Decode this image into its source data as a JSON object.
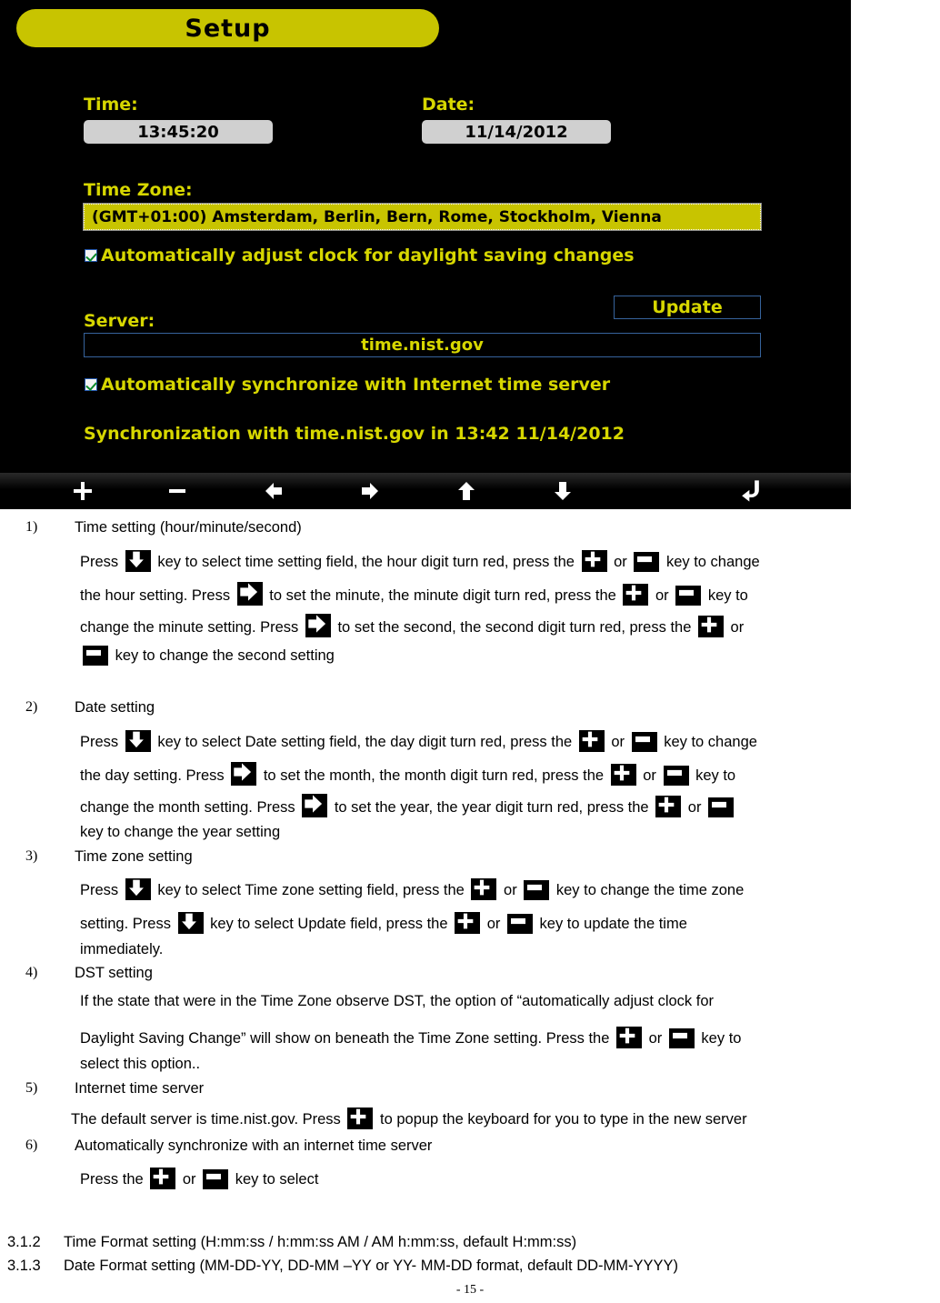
{
  "device": {
    "title": "Setup",
    "time_label": "Time:",
    "time_value": "13:45:20",
    "date_label": "Date:",
    "date_value": "11/14/2012",
    "timezone_label": "Time Zone:",
    "timezone_value": "(GMT+01:00) Amsterdam, Berlin, Bern, Rome, Stockholm, Vienna",
    "dst_checkbox_label": "Automatically adjust clock for daylight saving changes",
    "server_label": "Server:",
    "update_button": "Update",
    "server_value": "time.nist.gov",
    "sync_checkbox_label": "Automatically synchronize with Internet time server",
    "sync_status": "Synchronization with time.nist.gov in 13:42 11/14/2012",
    "colors": {
      "background": "#000000",
      "accent_yellow": "#c8c400",
      "label_yellow": "#d7d700",
      "field_grey": "#d0d0d0",
      "outline_blue": "#36639c"
    },
    "toolbar_icons": [
      "plus-icon",
      "minus-icon",
      "arrow-left-icon",
      "arrow-right-icon",
      "arrow-up-icon",
      "arrow-down-icon",
      "back-icon"
    ]
  },
  "manual": {
    "items": [
      {
        "number": "1)",
        "heading": "Time setting (hour/minute/second)",
        "lines": [
          [
            {
              "t": "text",
              "v": "Press "
            },
            {
              "t": "icon",
              "v": "arrow-down-key-icon"
            },
            {
              "t": "text",
              "v": " key to select time setting field, the hour digit turn red, press the "
            },
            {
              "t": "icon",
              "v": "plus-key-icon"
            },
            {
              "t": "text",
              "v": " or "
            },
            {
              "t": "icon",
              "v": "minus-key-icon"
            },
            {
              "t": "text",
              "v": " key to change"
            }
          ],
          [
            {
              "t": "text",
              "v": "the hour setting. Press "
            },
            {
              "t": "icon",
              "v": "arrow-right-key-icon"
            },
            {
              "t": "text",
              "v": " to set the minute, the minute digit turn red, press the "
            },
            {
              "t": "icon",
              "v": "plus-key-icon"
            },
            {
              "t": "text",
              "v": " or "
            },
            {
              "t": "icon",
              "v": "minus-key-icon"
            },
            {
              "t": "text",
              "v": " key to"
            }
          ],
          [
            {
              "t": "text",
              "v": "change the minute setting. Press "
            },
            {
              "t": "icon",
              "v": "arrow-right-key-icon"
            },
            {
              "t": "text",
              "v": " to set the second, the second digit turn red, press the "
            },
            {
              "t": "icon",
              "v": "plus-key-icon"
            },
            {
              "t": "text",
              "v": " or"
            }
          ],
          [
            {
              "t": "icon",
              "v": "minus-key-icon"
            },
            {
              "t": "text",
              "v": " key to change the second setting"
            }
          ]
        ]
      },
      {
        "number": "2)",
        "heading": "Date setting",
        "lines": [
          [
            {
              "t": "text",
              "v": "Press "
            },
            {
              "t": "icon",
              "v": "arrow-down-key-icon"
            },
            {
              "t": "text",
              "v": " key to select Date setting field, the day digit turn red, press the "
            },
            {
              "t": "icon",
              "v": "plus-key-icon"
            },
            {
              "t": "text",
              "v": " or "
            },
            {
              "t": "icon",
              "v": "minus-key-icon"
            },
            {
              "t": "text",
              "v": " key to change"
            }
          ],
          [
            {
              "t": "text",
              "v": "the day setting. Press "
            },
            {
              "t": "icon",
              "v": "arrow-right-key-icon"
            },
            {
              "t": "text",
              "v": " to set the month, the month digit turn red, press the "
            },
            {
              "t": "icon",
              "v": "plus-key-icon"
            },
            {
              "t": "text",
              "v": " or "
            },
            {
              "t": "icon",
              "v": "minus-key-icon"
            },
            {
              "t": "text",
              "v": " key to"
            }
          ],
          [
            {
              "t": "text",
              "v": "change the month setting. Press "
            },
            {
              "t": "icon",
              "v": "arrow-right-key-icon"
            },
            {
              "t": "text",
              "v": " to set the year, the year digit turn red, press the "
            },
            {
              "t": "icon",
              "v": "plus-key-icon"
            },
            {
              "t": "text",
              "v": " or "
            },
            {
              "t": "icon",
              "v": "minus-key-icon"
            }
          ],
          [
            {
              "t": "text",
              "v": "key to change the year setting"
            }
          ]
        ]
      },
      {
        "number": "3)",
        "heading": "Time zone setting",
        "lines": [
          [
            {
              "t": "text",
              "v": "Press "
            },
            {
              "t": "icon",
              "v": "arrow-down-key-icon"
            },
            {
              "t": "text",
              "v": " key to select Time zone setting field, press the "
            },
            {
              "t": "icon",
              "v": "plus-key-icon"
            },
            {
              "t": "text",
              "v": " or "
            },
            {
              "t": "icon",
              "v": "minus-key-icon"
            },
            {
              "t": "text",
              "v": " key to change the time zone"
            }
          ],
          [
            {
              "t": "text",
              "v": "setting.  Press  "
            },
            {
              "t": "icon",
              "v": "arrow-down-key-icon"
            },
            {
              "t": "text",
              "v": "  key  to  select  Update  field,  press  the  "
            },
            {
              "t": "icon",
              "v": "plus-key-icon"
            },
            {
              "t": "text",
              "v": "  or  "
            },
            {
              "t": "icon",
              "v": "minus-key-icon"
            },
            {
              "t": "text",
              "v": "  key  to  update  the  time"
            }
          ],
          [
            {
              "t": "text",
              "v": "immediately."
            }
          ]
        ]
      },
      {
        "number": "4)",
        "heading": "DST setting",
        "lines": [
          [
            {
              "t": "text",
              "v": "If  the  state  that  were  in  the  Time  Zone  observe  DST,  the  option  of  “automatically  adjust  clock  for"
            }
          ],
          [
            {
              "t": "text",
              "v": "Daylight Saving Change” will show on beneath the Time Zone setting. Press the "
            },
            {
              "t": "icon",
              "v": "plus-key-icon"
            },
            {
              "t": "text",
              "v": " or "
            },
            {
              "t": "icon",
              "v": "minus-key-icon"
            },
            {
              "t": "text",
              "v": " key to"
            }
          ],
          [
            {
              "t": "text",
              "v": "select this option.."
            }
          ]
        ]
      },
      {
        "number": "5)",
        "heading": "Internet time server",
        "lines": [
          [
            {
              "t": "text",
              "v": "The default server is time.nist.gov. Press "
            },
            {
              "t": "icon",
              "v": "plus-key-icon"
            },
            {
              "t": "text",
              "v": " to popup the keyboard for you to type in the new server"
            }
          ]
        ]
      },
      {
        "number": "6)",
        "heading": "Automatically synchronize with an internet time server",
        "lines": [
          [
            {
              "t": "text",
              "v": "Press the "
            },
            {
              "t": "icon",
              "v": "plus-key-icon"
            },
            {
              "t": "text",
              "v": " or "
            },
            {
              "t": "icon",
              "v": "minus-key-icon"
            },
            {
              "t": "text",
              "v": " key to select"
            }
          ]
        ]
      }
    ],
    "sections": [
      {
        "number": "3.1.2",
        "text": "Time Format setting (H:mm:ss / h:mm:ss AM / AM h:mm:ss, default H:mm:ss)"
      },
      {
        "number": "3.1.3",
        "text": "Date Format setting (MM-DD-YY, DD-MM –YY or YY- MM-DD format, default DD-MM-YYYY)"
      }
    ],
    "page_number": "- 15 -"
  }
}
